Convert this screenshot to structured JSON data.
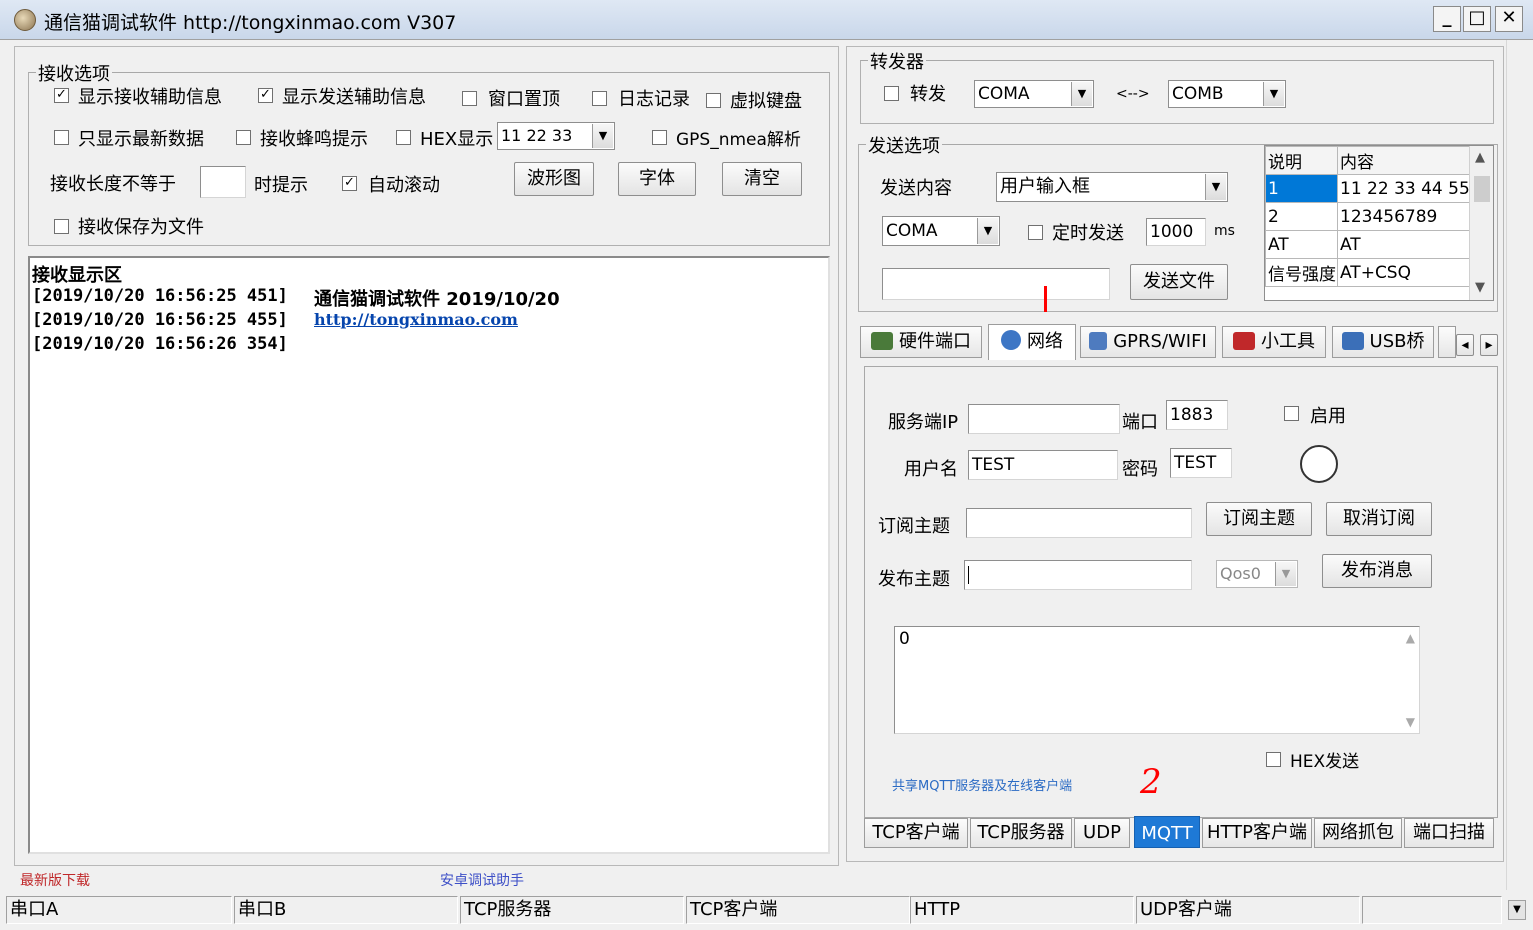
{
  "window": {
    "title": "通信猫调试软件  http://tongxinmao.com  V307",
    "min_btn": "_",
    "max_btn": "□",
    "close_btn": "✕"
  },
  "recv_options": {
    "legend": "接收选项",
    "show_recv_info": {
      "label": "显示接收辅助信息",
      "checked": true
    },
    "show_send_info": {
      "label": "显示发送辅助信息",
      "checked": true
    },
    "window_top": {
      "label": "窗口置顶",
      "checked": false
    },
    "log": {
      "label": "日志记录",
      "checked": false
    },
    "virtual_kb": {
      "label": "虚拟键盘",
      "checked": false
    },
    "latest_only": {
      "label": "只显示最新数据",
      "checked": false
    },
    "beep": {
      "label": "接收蜂鸣提示",
      "checked": false
    },
    "hex_show": {
      "label": "HEX显示",
      "checked": false
    },
    "hex_combo": "11 22 33",
    "gps": {
      "label": "GPS_nmea解析",
      "checked": false
    },
    "len_label": "接收长度不等于",
    "len_value": "",
    "len_suffix": "时提示",
    "auto_scroll": {
      "label": "自动滚动",
      "checked": true
    },
    "waveform_btn": "波形图",
    "font_btn": "字体",
    "clear_btn": "清空",
    "save_file": {
      "label": "接收保存为文件",
      "checked": false
    }
  },
  "recv_display": {
    "title": "接收显示区",
    "lines": [
      {
        "ts": "[2019/10/20 16:56:25 451]",
        "text": "通信猫调试软件    2019/10/20"
      },
      {
        "ts": "[2019/10/20 16:56:25 455]",
        "link": "http://tongxinmao.com"
      },
      {
        "ts": "[2019/10/20 16:56:26 354]"
      }
    ]
  },
  "forwarder": {
    "legend": "转发器",
    "forward": {
      "label": "转发",
      "checked": false
    },
    "port_a": "COMA",
    "arrow": "<-->",
    "port_b": "COMB"
  },
  "send_options": {
    "legend": "发送选项",
    "content_label": "发送内容",
    "content_combo": "用户输入框",
    "port_combo": "COMA",
    "timed": {
      "label": "定时发送",
      "checked": false
    },
    "interval": "1000",
    "interval_unit": "ms",
    "send_input": "",
    "send_file_btn": "发送文件",
    "table_headers": [
      "说明",
      "内容"
    ],
    "table_rows": [
      [
        "1",
        "11 22 33 44 55"
      ],
      [
        "2",
        "123456789"
      ],
      [
        "AT",
        "AT"
      ],
      [
        "信号强度",
        "AT+CSQ"
      ]
    ]
  },
  "top_tabs": [
    {
      "label": "硬件端口",
      "icon": "hardware-icon",
      "color": "#4a7a3a"
    },
    {
      "label": "网络",
      "icon": "network-icon",
      "color": "#3d76c5"
    },
    {
      "label": "GPRS/WIFI",
      "icon": "antenna-icon",
      "color": "#4e7bbf"
    },
    {
      "label": "小工具",
      "icon": "toolbox-icon",
      "color": "#c0282a"
    },
    {
      "label": "USB桥",
      "icon": "usb-icon",
      "color": "#3b6fb8"
    }
  ],
  "tab_scroll": {
    "left": "◂",
    "right": "▸"
  },
  "mqtt": {
    "server_ip_label": "服务端IP",
    "server_ip": "",
    "port_label": "端口",
    "port": "1883",
    "enable": {
      "label": "启用",
      "checked": false
    },
    "user_label": "用户名",
    "user": "TEST",
    "pwd_label": "密码",
    "pwd": "TEST",
    "sub_label": "订阅主题",
    "sub_topic": "",
    "sub_btn": "订阅主题",
    "unsub_btn": "取消订阅",
    "pub_label": "发布主题",
    "pub_topic": "",
    "qos": "Qos0",
    "pub_btn": "发布消息",
    "message": "0",
    "hex_send": {
      "label": "HEX发送",
      "checked": false
    },
    "shared_link": "共享MQTT服务器及在线客户端"
  },
  "bottom_tabs": [
    "TCP客户端",
    "TCP服务器",
    "UDP",
    "MQTT",
    "HTTP客户端",
    "网络抓包",
    "端口扫描"
  ],
  "active_bottom_tab": "MQTT",
  "links": {
    "latest": "最新版下载",
    "android": "安卓调试助手"
  },
  "status_bar": [
    "串口A",
    "串口B",
    "TCP服务器",
    "TCP客户端",
    "HTTP",
    "UDP客户端"
  ],
  "annotations": {
    "number": "2"
  },
  "colors": {
    "accent": "#0078d7",
    "link": "#0645ad",
    "red_link": "#c0282a",
    "active_tab": "#1e79d6",
    "annotation": "#ff0000"
  }
}
